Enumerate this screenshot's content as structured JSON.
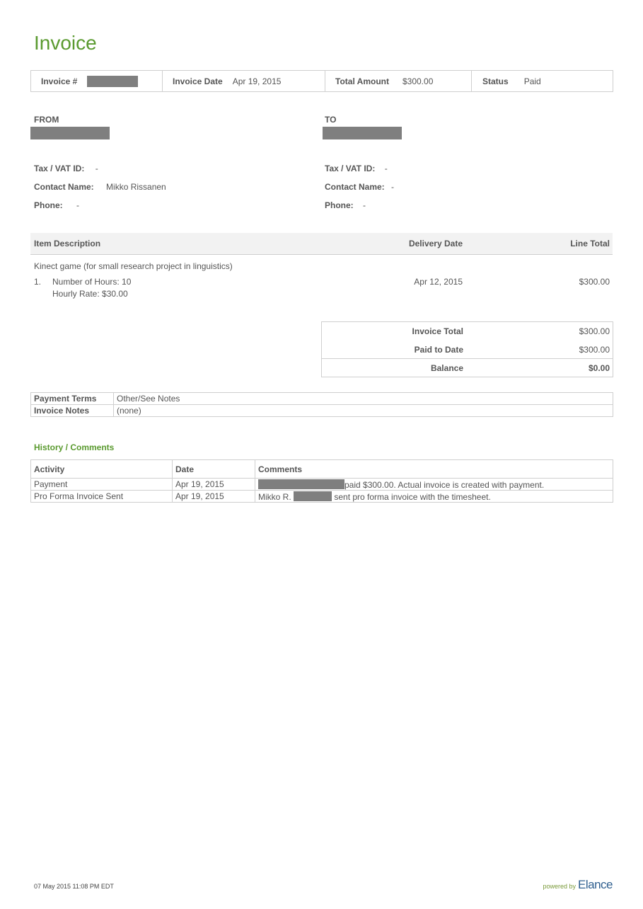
{
  "title": "Invoice",
  "summary": {
    "invoice_no_label": "Invoice #",
    "invoice_date_label": "Invoice Date",
    "invoice_date": "Apr 19, 2015",
    "total_amount_label": "Total Amount",
    "total_amount": "$300.00",
    "status_label": "Status",
    "status": "Paid"
  },
  "from": {
    "heading": "FROM",
    "tax_label": "Tax / VAT ID:",
    "tax_value": "-",
    "contact_label": "Contact Name:",
    "contact_value": "Mikko Rissanen",
    "phone_label": "Phone:",
    "phone_value": "-"
  },
  "to": {
    "heading": "TO",
    "tax_label": "Tax / VAT ID:",
    "tax_value": "-",
    "contact_label": "Contact Name:",
    "contact_value": "-",
    "phone_label": "Phone:",
    "phone_value": "-"
  },
  "items": {
    "col_description": "Item Description",
    "col_delivery": "Delivery Date",
    "col_total": "Line Total",
    "project": "Kinect game (for small research project in linguistics)",
    "rows": [
      {
        "number": "1.",
        "hours": "Number of Hours: 10",
        "rate": "Hourly Rate: $30.00",
        "delivery_date": "Apr 12, 2015",
        "line_total": "$300.00"
      }
    ]
  },
  "totals": {
    "invoice_total_label": "Invoice Total",
    "invoice_total": "$300.00",
    "paid_label": "Paid to Date",
    "paid": "$300.00",
    "balance_label": "Balance",
    "balance": "$0.00"
  },
  "terms": {
    "payment_terms_label": "Payment Terms",
    "payment_terms": "Other/See Notes",
    "notes_label": "Invoice Notes",
    "notes": "(none)"
  },
  "history": {
    "title": "History / Comments",
    "col_activity": "Activity",
    "col_date": "Date",
    "col_comments": "Comments",
    "rows": [
      {
        "activity": "Payment",
        "date": "Apr 19, 2015",
        "comment_prefix": "",
        "comment": "paid $300.00. Actual invoice is created with payment."
      },
      {
        "activity": "Pro Forma Invoice Sent",
        "date": "Apr 19, 2015",
        "comment_prefix": "Mikko R.",
        "comment": "sent pro forma invoice with the timesheet."
      }
    ]
  },
  "footer": {
    "generated": "07 May 2015 11:08 PM EDT",
    "powered_by": "powered by",
    "brand": "Elance"
  },
  "colors": {
    "accent_green": "#5a9a2f",
    "redaction_gray": "#7f7f7f",
    "brand_blue": "#2f5f8f"
  }
}
